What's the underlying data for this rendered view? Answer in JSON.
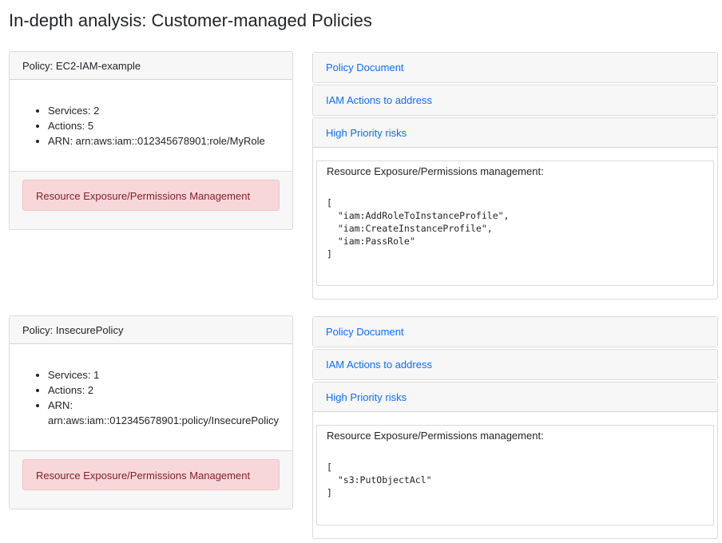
{
  "page": {
    "title": "In-depth analysis: Customer-managed Policies"
  },
  "policies": [
    {
      "header": "Policy: EC2-IAM-example",
      "services": "Services: 2",
      "actions": "Actions: 5",
      "arn": "ARN: arn:aws:iam::012345678901:role/MyRole",
      "alert": "Resource Exposure/Permissions Management",
      "accordion": {
        "policy_document": "Policy Document",
        "iam_actions": "IAM Actions to address",
        "high_priority": "High Priority risks",
        "risk_title": "Resource Exposure/Permissions management:",
        "risk_code": "[\n  \"iam:AddRoleToInstanceProfile\",\n  \"iam:CreateInstanceProfile\",\n  \"iam:PassRole\"\n]"
      }
    },
    {
      "header": "Policy: InsecurePolicy",
      "services": "Services: 1",
      "actions": "Actions: 2",
      "arn": "ARN: arn:aws:iam::012345678901:policy/InsecurePolicy",
      "alert": "Resource Exposure/Permissions Management",
      "accordion": {
        "policy_document": "Policy Document",
        "iam_actions": "IAM Actions to address",
        "high_priority": "High Priority risks",
        "risk_title": "Resource Exposure/Permissions management:",
        "risk_code": "[\n  \"s3:PutObjectAcl\"\n]"
      }
    }
  ],
  "colors": {
    "link": "#0d6efd",
    "alert_bg": "#f8d7da",
    "alert_text": "#842029",
    "header_bg": "#f7f7f7"
  }
}
